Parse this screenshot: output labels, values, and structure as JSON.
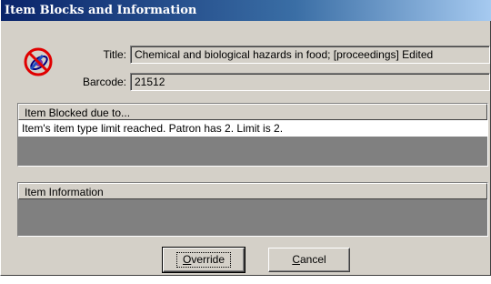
{
  "window": {
    "title": "Item Blocks and Information"
  },
  "icon": {
    "name": "blocked-item-icon"
  },
  "fields": {
    "title_label": "Title:",
    "title_value": "Chemical and biological hazards in food; [proceedings] Edited",
    "barcode_label": "Barcode:",
    "barcode_value": "21512"
  },
  "blocked_group": {
    "header": "Item Blocked due to...",
    "rows": [
      "Item's item type limit reached.  Patron has 2.  Limit is 2."
    ]
  },
  "info_group": {
    "header": "Item Information",
    "rows": []
  },
  "buttons": {
    "override": {
      "mnemonic": "O",
      "rest": "verride"
    },
    "cancel": {
      "mnemonic": "C",
      "rest": "ancel"
    }
  }
}
